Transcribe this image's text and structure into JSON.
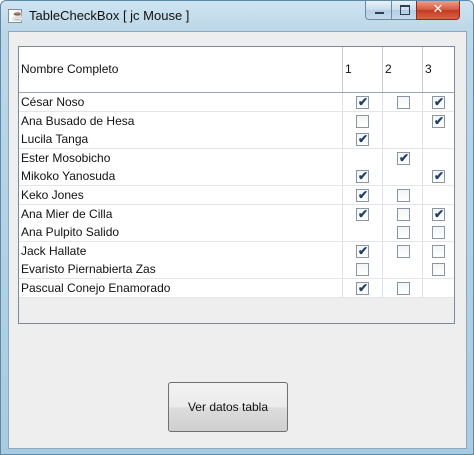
{
  "window": {
    "title": "TableCheckBox [ jc Mouse ]",
    "icon": "java-icon",
    "controls": {
      "minimize": "minimize-icon",
      "maximize": "maximize-icon",
      "close": "✕"
    }
  },
  "table": {
    "columns": [
      "Nombre Completo",
      "1",
      "2",
      "3"
    ],
    "rows": [
      {
        "name": "César Noso",
        "c1": true,
        "c2": false,
        "c3": true
      },
      {
        "name": "Ana Busado de Hesa",
        "c1": false,
        "c2": null,
        "c3": true
      },
      {
        "name": "Lucila Tanga",
        "c1": true,
        "c2": null,
        "c3": null
      },
      {
        "name": "Ester Mosobicho",
        "c1": null,
        "c2": true,
        "c3": null
      },
      {
        "name": "Mikoko Yanosuda",
        "c1": true,
        "c2": null,
        "c3": true
      },
      {
        "name": "Keko Jones",
        "c1": true,
        "c2": false,
        "c3": null
      },
      {
        "name": "Ana Mier de Cilla",
        "c1": true,
        "c2": false,
        "c3": true
      },
      {
        "name": "Ana Pulpito Salido",
        "c1": null,
        "c2": false,
        "c3": false
      },
      {
        "name": "Jack Hallate",
        "c1": true,
        "c2": false,
        "c3": false
      },
      {
        "name": "Evaristo Piernabierta Zas",
        "c1": false,
        "c2": null,
        "c3": false
      },
      {
        "name": "Pascual Conejo Enamorado",
        "c1": true,
        "c2": false,
        "c3": null
      }
    ]
  },
  "button": {
    "label": "Ver datos tabla"
  }
}
